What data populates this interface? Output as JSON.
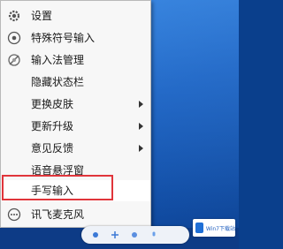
{
  "menu": {
    "items": [
      {
        "label": "设置",
        "icon": "gear-icon",
        "submenu": false
      },
      {
        "label": "特殊符号输入",
        "icon": "special-symbol-icon",
        "submenu": false
      },
      {
        "label": "输入法管理",
        "icon": "ime-manage-icon",
        "submenu": false
      },
      {
        "label": "隐藏状态栏",
        "icon": "",
        "submenu": false
      },
      {
        "label": "更换皮肤",
        "icon": "",
        "submenu": true
      },
      {
        "label": "更新升级",
        "icon": "",
        "submenu": true
      },
      {
        "label": "意见反馈",
        "icon": "",
        "submenu": true
      },
      {
        "label": "语音悬浮窗",
        "icon": "",
        "submenu": false
      },
      {
        "label": "手写输入",
        "icon": "",
        "submenu": false
      },
      {
        "label": "讯飞麦克风",
        "icon": "more-icon",
        "submenu": false
      }
    ],
    "highlighted_item": "手写输入"
  },
  "watermark": {
    "text": "Win7下载站"
  },
  "colors": {
    "highlight_border": "#e0353b",
    "menu_bg": "#f7f7f7",
    "desktop": "#0c52b8"
  }
}
